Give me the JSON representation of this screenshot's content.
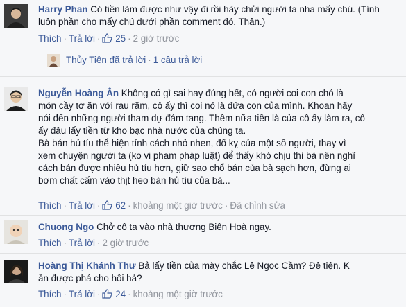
{
  "comments": [
    {
      "author": "Harry Phan",
      "text": "Có tiền làm được như vậy đi rồi hãy chửi người ta nha mấy chú. (Tính luôn phần cho mấy chú dưới phần comment đó. Thân.)",
      "like_label": "Thích",
      "reply_label": "Trả lời",
      "likes": "25",
      "time": "2 giờ trước",
      "reply_info": {
        "name": "Thủy Tiên đã trả lời",
        "count": "1 câu trả lời"
      }
    },
    {
      "author": "Nguyễn Hoàng Ân",
      "text_lines": [
        "Không có gì sai hay đúng hết, có người coi con chó là",
        "món cầy tơ ăn với rau răm, cô ấy thì coi nó là đứa con của mình. Khoan hãy",
        "nói đến những người tham dự đám tang. Thêm nữa tiền là của cô ấy làm ra, cô",
        "ấy đâu lấy tiền từ kho bạc nhà nước của chúng ta.",
        "Bà bán hủ tíu thể hiện tính cách nhỏ nhen, đố kỵ của một số người, thay vì",
        "xem chuyện người ta (ko vi pham pháp luật) để thấy khó chịu thì bà nên nghĩ",
        "cách bán được nhiều hủ tíu hơn, giữ sao chổ bán của bà sạch hơn, đừng ai",
        "bơm chất cấm vào thịt heo bán hủ tíu của bà..."
      ],
      "like_label": "Thích",
      "reply_label": "Trả lời",
      "likes": "62",
      "time": "khoảng một giờ trước",
      "edited": "Đã chỉnh sửa"
    },
    {
      "author": "Chuong Ngo",
      "text": "Chở cô ta vào nhà thương Biên Hoà ngay.",
      "like_label": "Thích",
      "reply_label": "Trả lời",
      "time": "2 giờ trước"
    },
    {
      "author": "Hoàng Thị Khánh Thư",
      "text_lines": [
        "Bả lấy tiền của mày chắc Lê Ngọc Cầm? Đê tiện. K",
        "ăn được phá cho hôi hả?"
      ],
      "like_label": "Thích",
      "reply_label": "Trả lời",
      "likes": "24",
      "time": "khoảng một giờ trước"
    }
  ],
  "colors": {
    "link": "#3b5998",
    "meta": "#90949c",
    "text": "#141823",
    "background": "#f6f7f9"
  }
}
